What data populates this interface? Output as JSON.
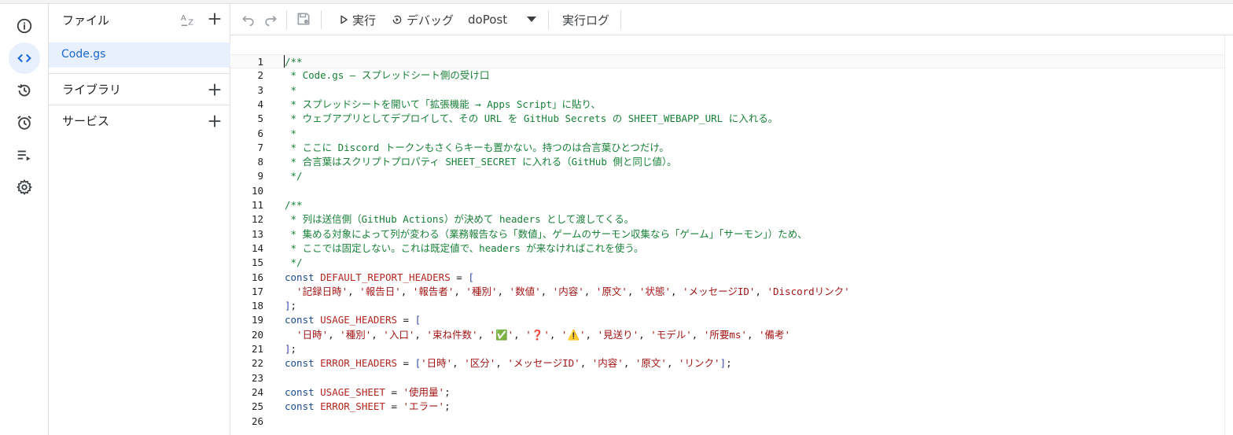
{
  "rail": {
    "items": [
      {
        "icon": "info-icon",
        "active": false
      },
      {
        "icon": "code-icon",
        "active": true
      },
      {
        "icon": "history-icon",
        "active": false
      },
      {
        "icon": "alarm-clock-icon",
        "active": false
      },
      {
        "icon": "execution-list-icon",
        "active": false
      },
      {
        "icon": "gear-icon",
        "active": false
      }
    ]
  },
  "files": {
    "title": "ファイル",
    "sort_icon": "sort-az-icon",
    "add_icon": "plus-icon",
    "items": [
      {
        "name": "Code.gs"
      }
    ],
    "libraries_label": "ライブラリ",
    "services_label": "サービス"
  },
  "toolbar": {
    "undo_icon": "undo-icon",
    "redo_icon": "redo-icon",
    "save_icon": "save-icon",
    "run_label": "実行",
    "debug_label": "デバッグ",
    "function_selected": "doPost",
    "log_label": "実行ログ"
  },
  "editor": {
    "current_line": 1,
    "lines": [
      {
        "n": "1",
        "tokens": [
          {
            "t": "/**",
            "c": "comment"
          }
        ]
      },
      {
        "n": "2",
        "tokens": [
          {
            "t": " * Code.gs — スプレッドシート側の受け口",
            "c": "comment"
          }
        ]
      },
      {
        "n": "3",
        "tokens": [
          {
            "t": " *",
            "c": "comment"
          }
        ]
      },
      {
        "n": "4",
        "tokens": [
          {
            "t": " * スプレッドシートを開いて「拡張機能 → Apps Script」に貼り、",
            "c": "comment"
          }
        ]
      },
      {
        "n": "5",
        "tokens": [
          {
            "t": " * ウェブアプリとしてデプロイして、その URL を GitHub Secrets の SHEET_WEBAPP_URL に入れる。",
            "c": "comment"
          }
        ]
      },
      {
        "n": "6",
        "tokens": [
          {
            "t": " *",
            "c": "comment"
          }
        ]
      },
      {
        "n": "7",
        "tokens": [
          {
            "t": " * ここに Discord トークンもさくらキーも置かない。持つのは合言葉ひとつだけ。",
            "c": "comment"
          }
        ]
      },
      {
        "n": "8",
        "tokens": [
          {
            "t": " * 合言葉はスクリプトプロパティ SHEET_SECRET に入れる（GitHub 側と同じ値）。",
            "c": "comment"
          }
        ]
      },
      {
        "n": "9",
        "tokens": [
          {
            "t": " */",
            "c": "comment"
          }
        ]
      },
      {
        "n": "10",
        "tokens": []
      },
      {
        "n": "11",
        "tokens": [
          {
            "t": "/**",
            "c": "comment"
          }
        ]
      },
      {
        "n": "12",
        "tokens": [
          {
            "t": " * 列は送信側（GitHub Actions）が決めて headers として渡してくる。",
            "c": "comment"
          }
        ]
      },
      {
        "n": "13",
        "tokens": [
          {
            "t": " * 集める対象によって列が変わる（業務報告なら「数値」、ゲームのサーモン収集なら「ゲーム」「サーモン」）ため、",
            "c": "comment"
          }
        ]
      },
      {
        "n": "14",
        "tokens": [
          {
            "t": " * ここでは固定しない。これは既定値で、headers が来なければこれを使う。",
            "c": "comment"
          }
        ]
      },
      {
        "n": "15",
        "tokens": [
          {
            "t": " */",
            "c": "comment"
          }
        ]
      },
      {
        "n": "16",
        "tokens": [
          {
            "t": "const ",
            "c": "keyword"
          },
          {
            "t": "DEFAULT_REPORT_HEADERS",
            "c": "var"
          },
          {
            "t": " = ",
            "c": "punct"
          },
          {
            "t": "[",
            "c": "bracket"
          }
        ]
      },
      {
        "n": "17",
        "tokens": [
          {
            "t": "  '記録日時'",
            "c": "str"
          },
          {
            "t": ", ",
            "c": "punct"
          },
          {
            "t": "'報告日'",
            "c": "str"
          },
          {
            "t": ", ",
            "c": "punct"
          },
          {
            "t": "'報告者'",
            "c": "str"
          },
          {
            "t": ", ",
            "c": "punct"
          },
          {
            "t": "'種別'",
            "c": "str"
          },
          {
            "t": ", ",
            "c": "punct"
          },
          {
            "t": "'数値'",
            "c": "str"
          },
          {
            "t": ", ",
            "c": "punct"
          },
          {
            "t": "'内容'",
            "c": "str"
          },
          {
            "t": ", ",
            "c": "punct"
          },
          {
            "t": "'原文'",
            "c": "str"
          },
          {
            "t": ", ",
            "c": "punct"
          },
          {
            "t": "'状態'",
            "c": "str"
          },
          {
            "t": ", ",
            "c": "punct"
          },
          {
            "t": "'メッセージID'",
            "c": "str"
          },
          {
            "t": ", ",
            "c": "punct"
          },
          {
            "t": "'Discordリンク'",
            "c": "str"
          }
        ]
      },
      {
        "n": "18",
        "tokens": [
          {
            "t": "]",
            "c": "bracket"
          },
          {
            "t": ";",
            "c": "punct"
          }
        ]
      },
      {
        "n": "19",
        "tokens": [
          {
            "t": "const ",
            "c": "keyword"
          },
          {
            "t": "USAGE_HEADERS",
            "c": "var"
          },
          {
            "t": " = ",
            "c": "punct"
          },
          {
            "t": "[",
            "c": "bracket"
          }
        ]
      },
      {
        "n": "20",
        "tokens": [
          {
            "t": "  '日時'",
            "c": "str"
          },
          {
            "t": ", ",
            "c": "punct"
          },
          {
            "t": "'種別'",
            "c": "str"
          },
          {
            "t": ", ",
            "c": "punct"
          },
          {
            "t": "'入口'",
            "c": "str"
          },
          {
            "t": ", ",
            "c": "punct"
          },
          {
            "t": "'束ね件数'",
            "c": "str"
          },
          {
            "t": ", ",
            "c": "punct"
          },
          {
            "t": "'✅'",
            "c": "str"
          },
          {
            "t": ", ",
            "c": "punct"
          },
          {
            "t": "'❓'",
            "c": "str"
          },
          {
            "t": ", ",
            "c": "punct"
          },
          {
            "t": "'⚠️'",
            "c": "str"
          },
          {
            "t": ", ",
            "c": "punct"
          },
          {
            "t": "'見送り'",
            "c": "str"
          },
          {
            "t": ", ",
            "c": "punct"
          },
          {
            "t": "'モデル'",
            "c": "str"
          },
          {
            "t": ", ",
            "c": "punct"
          },
          {
            "t": "'所要ms'",
            "c": "str"
          },
          {
            "t": ", ",
            "c": "punct"
          },
          {
            "t": "'備考'",
            "c": "str"
          }
        ]
      },
      {
        "n": "21",
        "tokens": [
          {
            "t": "]",
            "c": "bracket"
          },
          {
            "t": ";",
            "c": "punct"
          }
        ]
      },
      {
        "n": "22",
        "tokens": [
          {
            "t": "const ",
            "c": "keyword"
          },
          {
            "t": "ERROR_HEADERS",
            "c": "var"
          },
          {
            "t": " = ",
            "c": "punct"
          },
          {
            "t": "[",
            "c": "bracket"
          },
          {
            "t": "'日時'",
            "c": "str"
          },
          {
            "t": ", ",
            "c": "punct"
          },
          {
            "t": "'区分'",
            "c": "str"
          },
          {
            "t": ", ",
            "c": "punct"
          },
          {
            "t": "'メッセージID'",
            "c": "str"
          },
          {
            "t": ", ",
            "c": "punct"
          },
          {
            "t": "'内容'",
            "c": "str"
          },
          {
            "t": ", ",
            "c": "punct"
          },
          {
            "t": "'原文'",
            "c": "str"
          },
          {
            "t": ", ",
            "c": "punct"
          },
          {
            "t": "'リンク'",
            "c": "str"
          },
          {
            "t": "]",
            "c": "bracket"
          },
          {
            "t": ";",
            "c": "punct"
          }
        ]
      },
      {
        "n": "23",
        "tokens": []
      },
      {
        "n": "24",
        "tokens": [
          {
            "t": "const ",
            "c": "keyword"
          },
          {
            "t": "USAGE_SHEET",
            "c": "var"
          },
          {
            "t": " = ",
            "c": "punct"
          },
          {
            "t": "'使用量'",
            "c": "str"
          },
          {
            "t": ";",
            "c": "punct"
          }
        ]
      },
      {
        "n": "25",
        "tokens": [
          {
            "t": "const ",
            "c": "keyword"
          },
          {
            "t": "ERROR_SHEET",
            "c": "var"
          },
          {
            "t": " = ",
            "c": "punct"
          },
          {
            "t": "'エラー'",
            "c": "str"
          },
          {
            "t": ";",
            "c": "punct"
          }
        ]
      },
      {
        "n": "26",
        "tokens": []
      }
    ]
  }
}
